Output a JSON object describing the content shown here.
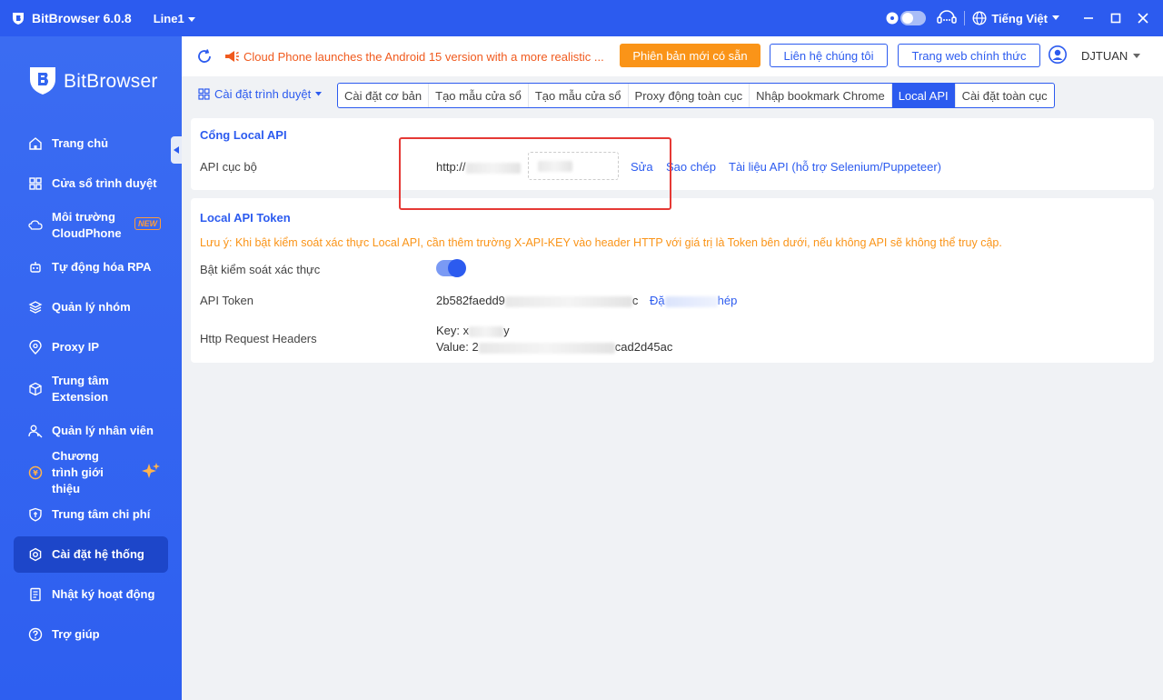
{
  "window": {
    "app_title": "BitBrowser 6.0.8",
    "line": "Line1",
    "language": "Tiếng Việt"
  },
  "sidebar": {
    "brand": "BitBrowser",
    "items": [
      {
        "label": "Trang chủ",
        "icon": "home-icon"
      },
      {
        "label": "Cửa sổ trình duyệt",
        "icon": "grid-icon"
      },
      {
        "label": "Môi trường CloudPhone",
        "icon": "phone-icon",
        "badge": "NEW"
      },
      {
        "label": "Tự động hóa RPA",
        "icon": "robot-icon"
      },
      {
        "label": "Quản lý nhóm",
        "icon": "layers-icon"
      },
      {
        "label": "Proxy IP",
        "icon": "location-icon"
      },
      {
        "label": "Trung tâm Extension",
        "icon": "cube-icon"
      },
      {
        "label": "Quản lý nhân viên",
        "icon": "users-icon"
      },
      {
        "label": "Chương trình giới thiệu",
        "icon": "coin-icon"
      },
      {
        "label": "Trung tâm chi phí",
        "icon": "shield-icon"
      },
      {
        "label": "Cài đặt hệ thống",
        "icon": "settings-icon",
        "active": true
      },
      {
        "label": "Nhật ký hoạt động",
        "icon": "log-icon"
      },
      {
        "label": "Trợ giúp",
        "icon": "help-icon"
      }
    ]
  },
  "topbar": {
    "notice": "Cloud Phone launches the Android 15 version with a more realistic ...",
    "new_version": "Phiên bản mới có sẵn",
    "contact": "Liên hệ chúng tôi",
    "website": "Trang web chính thức",
    "username": "DJTUAN"
  },
  "settings": {
    "dropdown": "Cài đặt trình duyệt",
    "tabs": [
      {
        "label": "Cài đặt cơ bản"
      },
      {
        "label": "Tạo mẫu cửa sổ"
      },
      {
        "label": "Tạo mẫu cửa sổ"
      },
      {
        "label": "Proxy động toàn cục"
      },
      {
        "label": "Nhập bookmark Chrome"
      },
      {
        "label": "Local API",
        "active": true
      },
      {
        "label": "Cài đặt toàn cục"
      }
    ]
  },
  "local_api": {
    "title": "Cổng Local API",
    "label": "API cục bộ",
    "url_prefix": "http://",
    "edit": "Sửa",
    "copy": "Sao chép",
    "docs": "Tài liệu API (hỗ trợ Selenium/Puppeteer)"
  },
  "token": {
    "title": "Local API Token",
    "warning": "Lưu ý: Khi bật kiểm soát xác thực Local API, cần thêm trường X-API-KEY vào header HTTP với giá trị là Token bên dưới, nếu không API sẽ không thể truy cập.",
    "auth_label": "Bật kiểm soát xác thực",
    "auth_enabled": true,
    "token_label": "API Token",
    "token_start": "2b582faedd9",
    "token_end": "c",
    "token_action_start": "Đặ",
    "token_action_end": "hép",
    "headers_label": "Http Request Headers",
    "key_start": "Key: x",
    "key_end": "y",
    "value_start": "Value: 2",
    "value_end": "cad2d45ac"
  },
  "colors": {
    "primary": "#2c5bef",
    "sidebar": "#3061f0",
    "orange": "#fa9418",
    "notice": "#f05a1e",
    "highlight_box": "#e53935"
  }
}
